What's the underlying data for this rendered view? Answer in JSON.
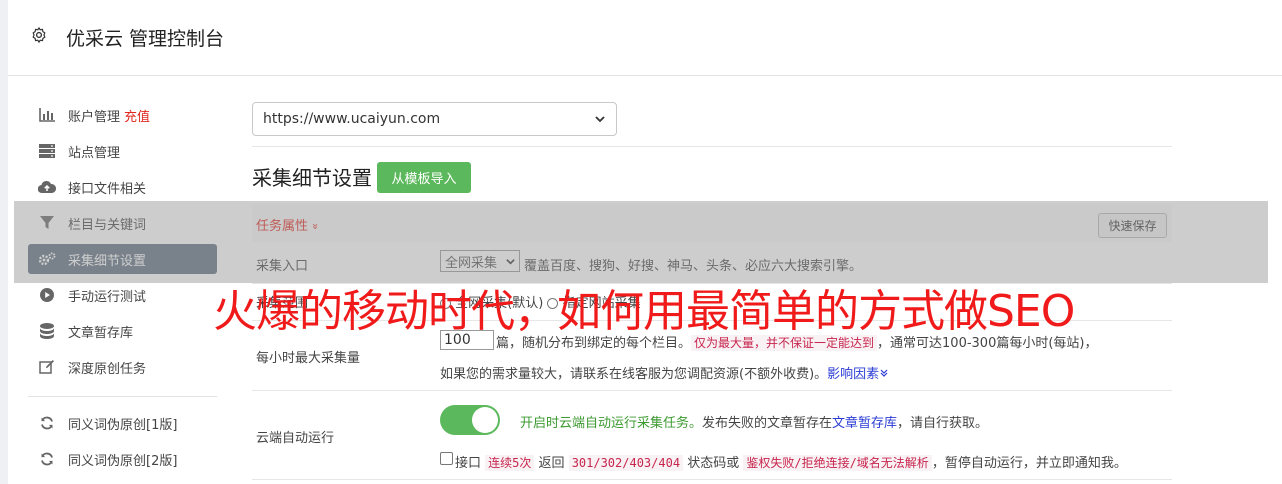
{
  "header": {
    "title": "优采云 管理控制台",
    "icon": "gear-icon"
  },
  "sidebar": {
    "items": [
      {
        "label": "账户管理",
        "badge": "充值",
        "icon": "bar-chart-icon"
      },
      {
        "label": "站点管理",
        "icon": "server-icon"
      },
      {
        "label": "接口文件相关",
        "icon": "cloud-upload-icon"
      },
      {
        "label": "栏目与关键词",
        "icon": "filter-icon"
      },
      {
        "label": "采集细节设置",
        "icon": "cogs-icon",
        "active": true
      },
      {
        "label": "手动运行测试",
        "icon": "play-circle-icon"
      },
      {
        "label": "文章暂存库",
        "icon": "database-icon"
      },
      {
        "label": "深度原创任务",
        "icon": "edit-icon"
      },
      {
        "label": "同义词伪原创[1版]",
        "icon": "refresh-icon"
      },
      {
        "label": "同义词伪原创[2版]",
        "icon": "refresh-icon"
      }
    ]
  },
  "site_select": {
    "value": "https://www.ucaiyun.com"
  },
  "section": {
    "title": "采集细节设置",
    "import_label": "从模板导入"
  },
  "task": {
    "label": "任务属性",
    "label_suffix": "»",
    "quick_save": "快速保存"
  },
  "collect_entry": {
    "label": "采集入口",
    "select_value": "全网采集",
    "desc": "覆盖百度、搜狗、好搜、神马、头条、必应六大搜索引擎。"
  },
  "collect_scope": {
    "label": "采集范围",
    "opt1": "全网采集(默认)",
    "opt2": "指定网站采集"
  },
  "hourly": {
    "label": "每小时最大采集量",
    "value": "100",
    "text1": "篇，随机分布到绑定的每个栏目。",
    "note": "仅为最大量，并不保证一定能达到",
    "text2": "，通常可达100-300篇每小时(每站)，",
    "text3": "如果您的需求量较大，请联系在线客服为您调配资源(不额外收费)。",
    "link": "影响因素"
  },
  "cloud": {
    "label": "云端自动运行",
    "toggle_on": true,
    "green_text": "开启时云端自动运行采集任务。",
    "text1": "发布失败的文章暂存在",
    "link": "文章暂存库",
    "text2": "，请自行获取。",
    "cb_text1": "接口",
    "red1": "连续5次",
    "cb_text2": "返回",
    "red2": "301/302/403/404",
    "cb_text3": "状态码或",
    "red3": "鉴权失败/拒绝连接/域名无法解析",
    "cb_text4": "，暂停自动运行，并立即通知我。"
  },
  "overlay": {
    "text": "火爆的移动时代，如何用最简单的方式做SEO"
  },
  "colors": {
    "accent_green": "#5cb85c",
    "active_nav": "#5f6f81",
    "red": "#e1261c",
    "overlay_red": "#f01a1a"
  }
}
